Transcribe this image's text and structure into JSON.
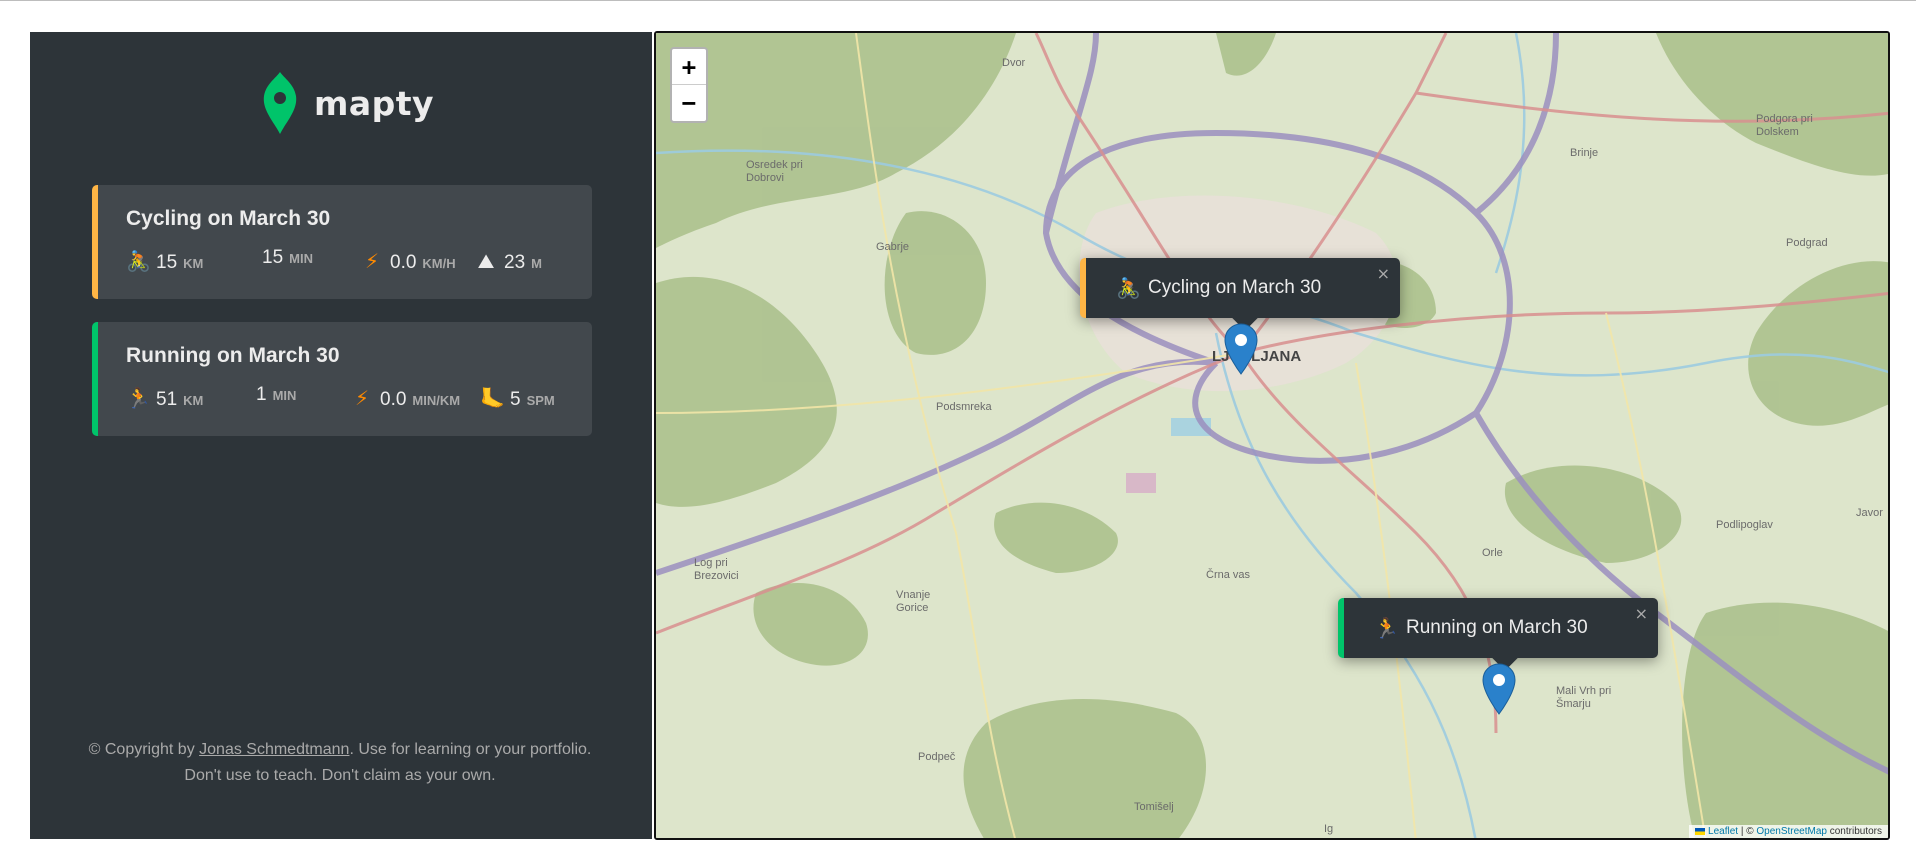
{
  "app": {
    "name": "mapty"
  },
  "workouts": [
    {
      "type": "cycling",
      "title": "Cycling on March 30",
      "details": [
        {
          "icon": "🚴",
          "value": "15",
          "unit": "km"
        },
        {
          "icon": "",
          "value": "15",
          "unit": "min"
        },
        {
          "icon": "⚡",
          "value": "0.0",
          "unit": "km/h"
        },
        {
          "icon": "⛰",
          "value": "23",
          "unit": "m"
        }
      ]
    },
    {
      "type": "running",
      "title": "Running on March 30",
      "details": [
        {
          "icon": "🏃",
          "value": "51",
          "unit": "km"
        },
        {
          "icon": "",
          "value": "1",
          "unit": "min"
        },
        {
          "icon": "⚡",
          "value": "0.0",
          "unit": "min/km"
        },
        {
          "icon": "🦶",
          "value": "5",
          "unit": "spm"
        }
      ]
    }
  ],
  "copyright": {
    "prefix": "© Copyright by ",
    "author": "Jonas Schmedtmann",
    "suffix": ". Use for learning or your portfolio. Don't use to teach. Don't claim as your own."
  },
  "map": {
    "zoom_in": "+",
    "zoom_out": "−",
    "popups": [
      {
        "icon": "🚴",
        "text": "Cycling on March 30",
        "close": "×"
      },
      {
        "icon": "🏃",
        "text": "Running on March 30",
        "close": "×"
      }
    ],
    "city_label": "LJUBLJANA",
    "place_labels": [
      "Dvor",
      "Osredek pri Dobrovi",
      "Gabrje",
      "Podsmreka",
      "Log pri Brezovici",
      "Vnanje Gorice",
      "Črna vas",
      "Podpeč",
      "Tomišelj",
      "Ig",
      "Orle",
      "Podlipoglav",
      "Podgrad",
      "Brinje",
      "Podgora pri Dolskem",
      "Mali Vrh pri Šmarju",
      "Javor"
    ],
    "attribution": {
      "leaflet": "Leaflet",
      "sep": " | © ",
      "osm": "OpenStreetMap",
      "suffix": " contributors"
    }
  },
  "colors": {
    "cycling": "#ffb545",
    "running": "#00c46a",
    "sidebar": "#2d3439",
    "card": "#42484d",
    "marker": "#2a81cb"
  }
}
